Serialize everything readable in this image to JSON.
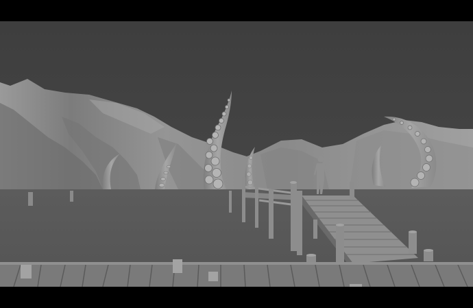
{
  "scene": {
    "letterbox_color": "#000000",
    "sky_color": "#3f3f3f",
    "water_color": "#595959",
    "mountain_color": "#8e8e8e",
    "mountain_shadow_color": "#6a6a6a",
    "wood_color": "#8a8a8a",
    "wood_dark_color": "#5e5e5e",
    "tentacle_color": "#9a9a9a",
    "figure_color": "#8f8f8f"
  },
  "icons": [
    "tentacle-icon",
    "pier-icon",
    "figure-icon",
    "mountain-icon"
  ]
}
